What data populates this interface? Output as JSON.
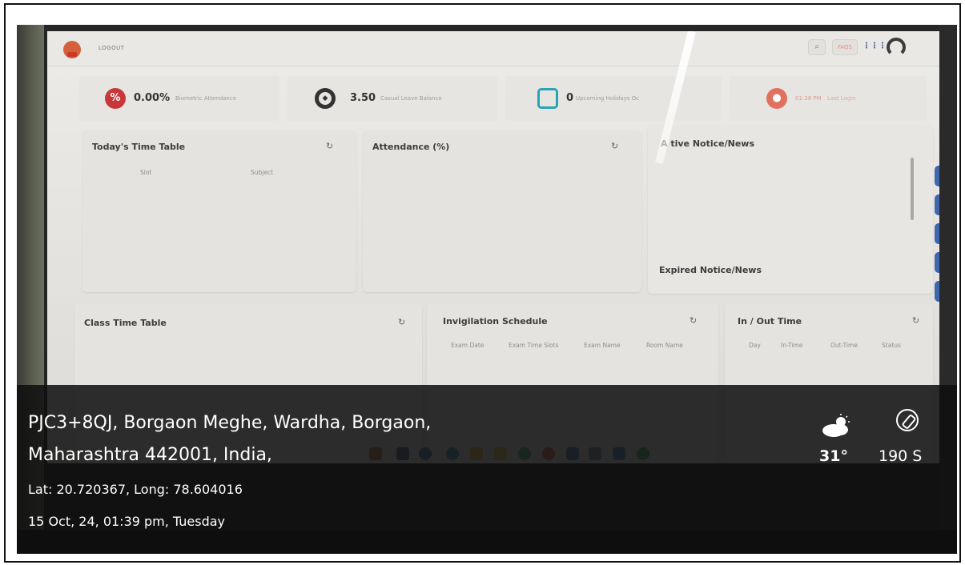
{
  "topbar": {
    "logout_label": "LOGOUT",
    "faq_label": "FAQS"
  },
  "stats": [
    {
      "value": "0.00%",
      "label": "Biometric Attendance",
      "icon": "percent-icon",
      "color": "#c8383a"
    },
    {
      "value": "3.50",
      "label": "Casual Leave Balance",
      "icon": "leave-icon",
      "color": "#333333"
    },
    {
      "value": "0",
      "label": "Upcoming Holidays  Oc",
      "icon": "calendar-icon",
      "color": "#2aa3b5"
    },
    {
      "value": "01:38 PM",
      "label": "Last Login",
      "icon": "user-icon",
      "color": "#e0715f"
    }
  ],
  "panels": {
    "todays_timetable": {
      "title": "Today's Time Table",
      "columns": [
        "Slot",
        "Subject"
      ]
    },
    "attendance": {
      "title": "Attendance (%)"
    },
    "notice": {
      "active_title": "A  tive Notice/News",
      "expired_title": "Expired Notice/News"
    },
    "class_timetable": {
      "title": "Class Time Table"
    },
    "invigilation": {
      "title": "Invigilation Schedule",
      "columns": [
        "Exam Date",
        "Exam Time Slots",
        "Exam Name",
        "Room Name"
      ]
    },
    "in_out": {
      "title": "In / Out Time",
      "columns": [
        "Day",
        "In-Time",
        "Out-Time",
        "Status"
      ]
    }
  },
  "side_tools": [
    "doc-icon",
    "settings-icon",
    "info-icon",
    "link-icon",
    "star-icon"
  ],
  "overlay": {
    "address_line1": "PJC3+8QJ, Borgaon Meghe, Wardha, Borgaon,",
    "address_line2": "Maharashtra 442001, India,",
    "coordinates": "Lat: 20.720367, Long: 78.604016",
    "datetime": "15 Oct, 24, 01:39 pm, Tuesday",
    "temperature": "31°",
    "heading": "190 S"
  }
}
